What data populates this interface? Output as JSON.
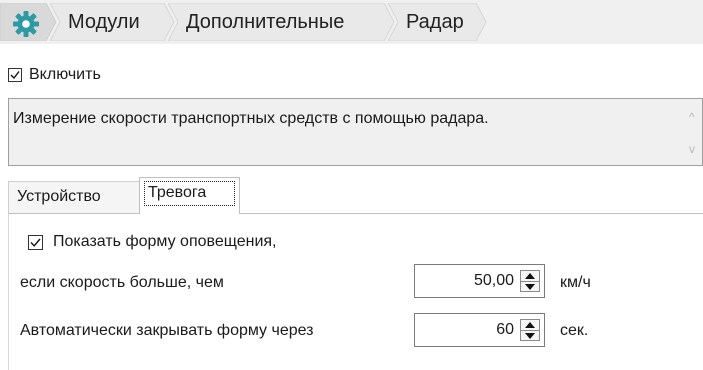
{
  "breadcrumb": {
    "home_icon": "gear-icon",
    "items": [
      {
        "label": "Модули"
      },
      {
        "label": "Дополнительные"
      },
      {
        "label": "Радар"
      }
    ]
  },
  "enable": {
    "label": "Включить",
    "checked": true
  },
  "description": {
    "text": "Измерение скорости транспортных средств с помощью радара."
  },
  "tabs": [
    {
      "label": "Устройство",
      "active": false
    },
    {
      "label": "Тревога",
      "active": true
    }
  ],
  "alarm": {
    "show_form": {
      "label": "Показать форму оповещения,",
      "checked": true
    },
    "speed": {
      "label": "если скорость больше, чем",
      "value": "50,00",
      "unit": "км/ч"
    },
    "autoclose": {
      "label": "Автоматически закрывать форму через",
      "value": "60",
      "unit": "сек."
    }
  },
  "colors": {
    "accent": "#2e9aa3",
    "chevron_fill": "#e9e9e9",
    "chevron_active": "#dcdcdc"
  }
}
